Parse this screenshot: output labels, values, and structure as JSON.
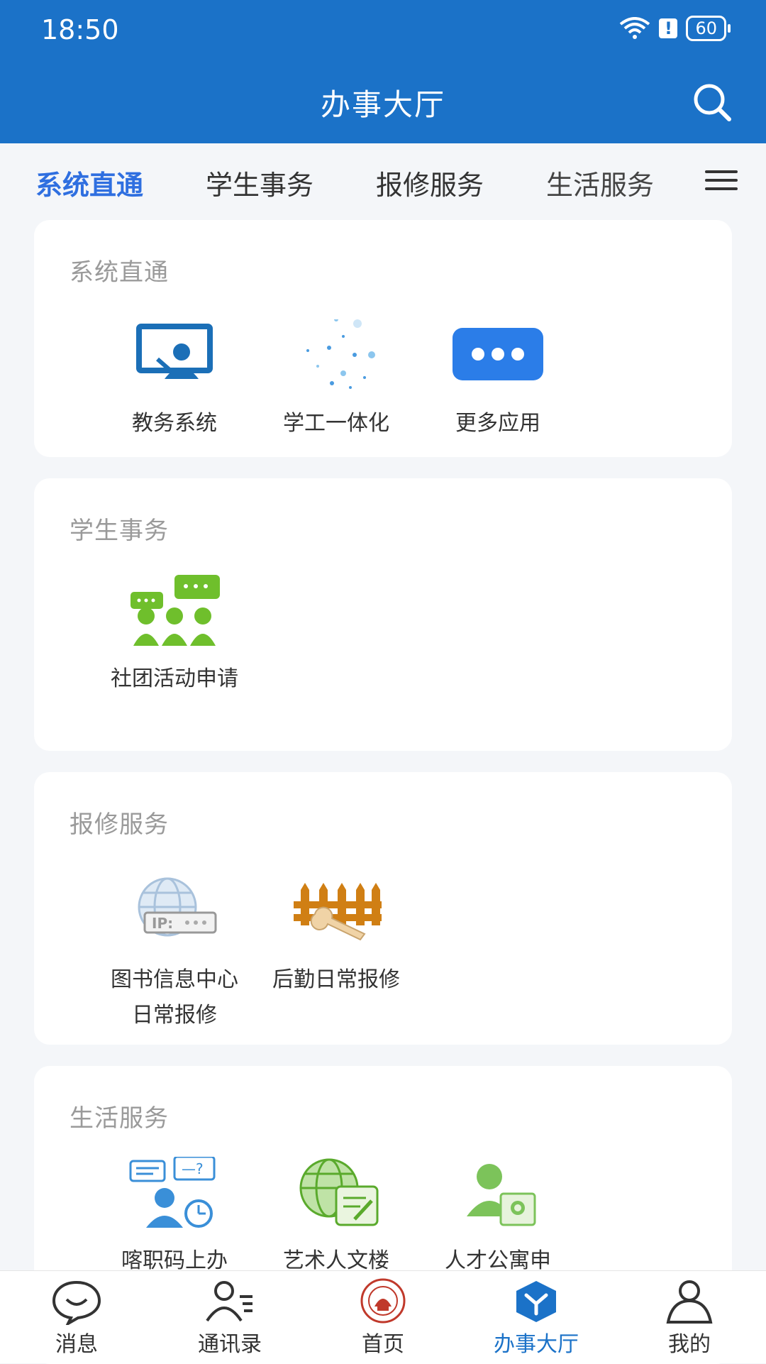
{
  "status": {
    "time": "18:50",
    "battery": "60"
  },
  "header": {
    "title": "办事大厅"
  },
  "tabs": [
    {
      "label": "系统直通"
    },
    {
      "label": "学生事务"
    },
    {
      "label": "报修服务"
    },
    {
      "label": "生活服务"
    }
  ],
  "sections": {
    "system": {
      "title": "系统直通",
      "items": [
        {
          "label": "教务系统"
        },
        {
          "label": "学工一体化"
        },
        {
          "label": "更多应用"
        }
      ]
    },
    "student": {
      "title": "学生事务",
      "items": [
        {
          "label": "社团活动申请"
        }
      ]
    },
    "repair": {
      "title": "报修服务",
      "items": [
        {
          "label": "图书信息中心日常报修"
        },
        {
          "label": "后勤日常报修"
        }
      ]
    },
    "life": {
      "title": "生活服务",
      "items": [
        {
          "label": "喀职码上办"
        },
        {
          "label": "艺术人文楼"
        },
        {
          "label": "人才公寓申"
        }
      ]
    }
  },
  "bottom_nav": [
    {
      "label": "消息"
    },
    {
      "label": "通讯录"
    },
    {
      "label": "首页"
    },
    {
      "label": "办事大厅"
    },
    {
      "label": "我的"
    }
  ],
  "colors": {
    "primary": "#1b72c8",
    "active_tab": "#2f6fe0",
    "green_icon": "#6fbf2c"
  }
}
